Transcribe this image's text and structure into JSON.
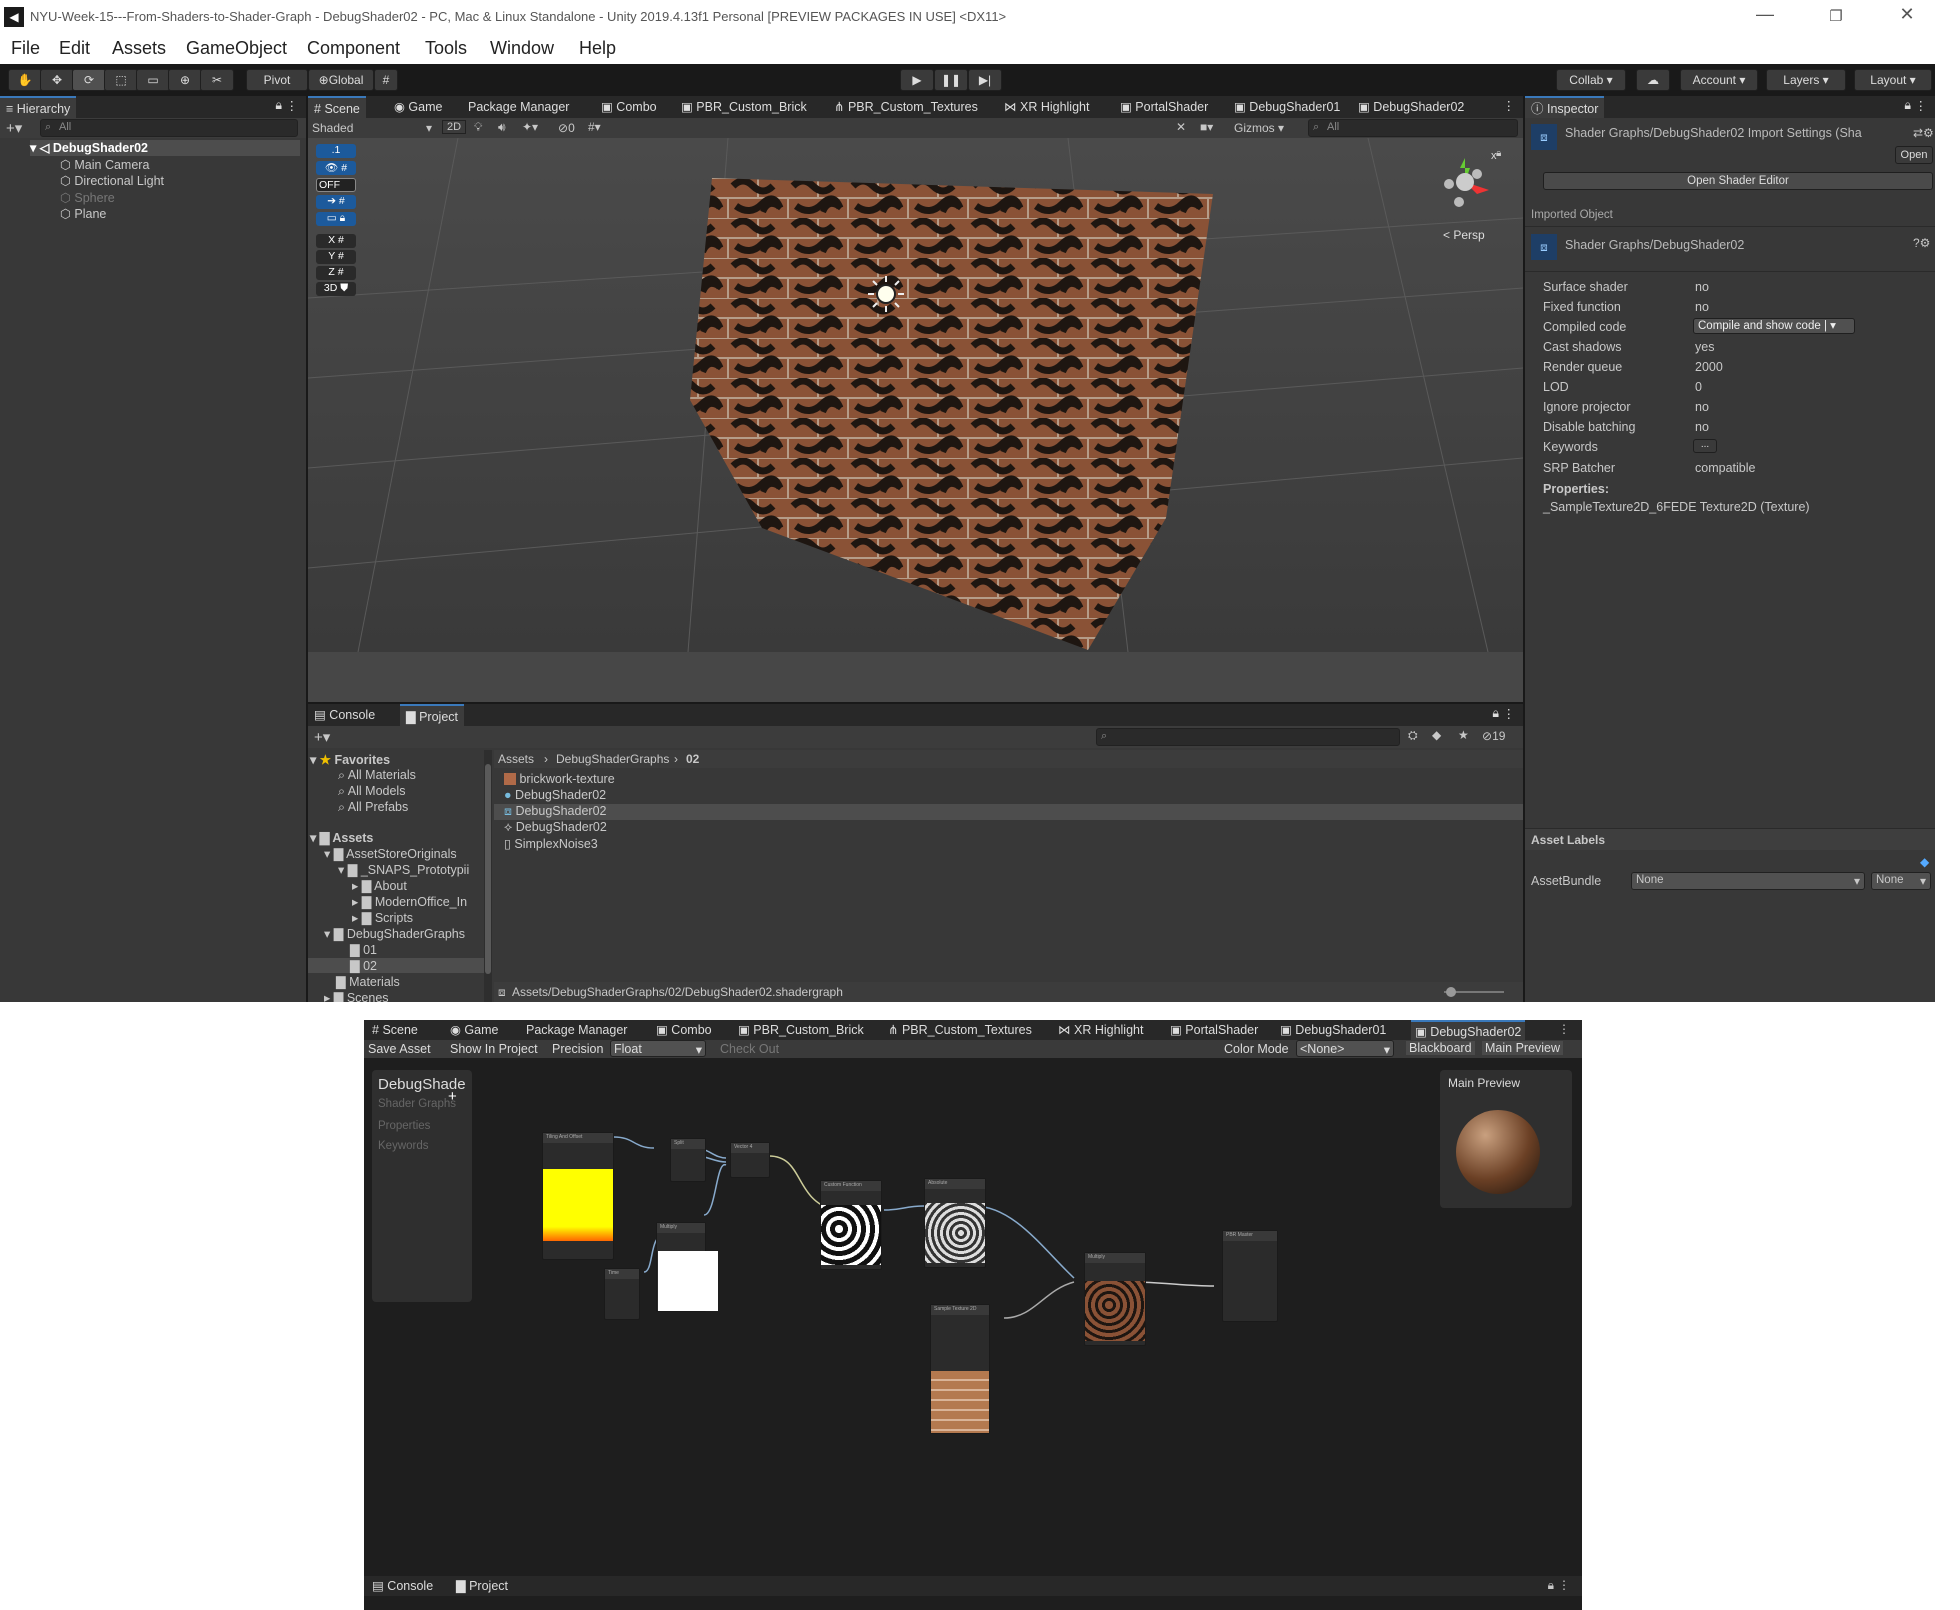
{
  "window": {
    "title": "NYU-Week-15---From-Shaders-to-Shader-Graph - DebugShader02 - PC, Mac & Linux Standalone - Unity 2019.4.13f1 Personal [PREVIEW PACKAGES IN USE] <DX11>",
    "menu": [
      "File",
      "Edit",
      "Assets",
      "GameObject",
      "Component",
      "Tools",
      "Window",
      "Help"
    ]
  },
  "toolbar": {
    "pivot": "Pivot",
    "global": "Global",
    "collab": "Collab",
    "account": "Account",
    "layers": "Layers",
    "layout": "Layout"
  },
  "hierarchy": {
    "tab": "Hierarchy",
    "search_placeholder": "All",
    "scene": "DebugShader02",
    "items": [
      {
        "label": "Main Camera"
      },
      {
        "label": "Directional Light"
      },
      {
        "label": "Sphere"
      },
      {
        "label": "Plane"
      }
    ]
  },
  "scene_tabs": [
    "Scene",
    "Game",
    "Package Manager",
    "Combo",
    "PBR_Custom_Brick",
    "PBR_Custom_Textures",
    "XR Highlight",
    "PortalShader",
    "DebugShader01",
    "DebugShader02"
  ],
  "scene_toolbar": {
    "shading": "Shaded",
    "mode2d": "2D",
    "hidden_count": "0",
    "gizmos": "Gizmos",
    "search_placeholder": "All"
  },
  "scene_overlay": {
    "snap_value": ".1",
    "off": "OFF",
    "x": "X",
    "y": "Y",
    "z": "Z",
    "three_d": "3D",
    "persp": "< Persp",
    "gizmo_y": "y",
    "gizmo_x": "x"
  },
  "inspector": {
    "tab": "Inspector",
    "header": "Shader Graphs/DebugShader02 Import Settings (Sha",
    "open": "Open",
    "open_editor": "Open Shader Editor",
    "imported_object": "Imported Object",
    "object_name": "Shader Graphs/DebugShader02",
    "props": [
      {
        "k": "Surface shader",
        "v": "no"
      },
      {
        "k": "Fixed function",
        "v": "no"
      },
      {
        "k": "Compiled code",
        "v": "Compile and show code"
      },
      {
        "k": "Cast shadows",
        "v": "yes"
      },
      {
        "k": "Render queue",
        "v": "2000"
      },
      {
        "k": "LOD",
        "v": "0"
      },
      {
        "k": "Ignore projector",
        "v": "no"
      },
      {
        "k": "Disable batching",
        "v": "no"
      },
      {
        "k": "Keywords",
        "v": "..."
      },
      {
        "k": "SRP Batcher",
        "v": "compatible"
      }
    ],
    "properties_label": "Properties:",
    "property_item": "_SampleTexture2D_6FEDE Texture2D (Texture)",
    "asset_labels": "Asset Labels",
    "asset_bundle": "AssetBundle",
    "bundle_value": "None",
    "bundle_variant": "None"
  },
  "project": {
    "tabs": [
      "Console",
      "Project"
    ],
    "hidden_count": "19",
    "favorites": "Favorites",
    "fav_items": [
      "All Materials",
      "All Models",
      "All Prefabs"
    ],
    "tree": [
      {
        "label": "Assets",
        "bold": true,
        "depth": 0
      },
      {
        "label": "AssetStoreOriginals",
        "depth": 1
      },
      {
        "label": "_SNAPS_Prototypii",
        "depth": 2
      },
      {
        "label": "About",
        "depth": 3
      },
      {
        "label": "ModernOffice_In",
        "depth": 3
      },
      {
        "label": "Scripts",
        "depth": 3
      },
      {
        "label": "DebugShaderGraphs",
        "depth": 1
      },
      {
        "label": "01",
        "depth": 2
      },
      {
        "label": "02",
        "depth": 2,
        "selected": true
      },
      {
        "label": "Materials",
        "depth": 1
      },
      {
        "label": "Scenes",
        "depth": 1
      },
      {
        "label": "Scripts",
        "depth": 1
      },
      {
        "label": "Settings",
        "depth": 1
      },
      {
        "label": "Shaders",
        "depth": 1
      }
    ],
    "breadcrumb": [
      "Assets",
      "DebugShaderGraphs",
      "02"
    ],
    "files": [
      {
        "label": "brickwork-texture",
        "icon": "texture-icon"
      },
      {
        "label": "DebugShader02",
        "icon": "material-icon"
      },
      {
        "label": "DebugShader02",
        "icon": "shadergraph-icon",
        "selected": true
      },
      {
        "label": "DebugShader02",
        "icon": "shader-icon"
      },
      {
        "label": "SimplexNoise3",
        "icon": "script-icon"
      }
    ],
    "path": "Assets/DebugShaderGraphs/02/DebugShader02.shadergraph"
  },
  "graph_editor": {
    "tabs": [
      "Scene",
      "Game",
      "Package Manager",
      "Combo",
      "PBR_Custom_Brick",
      "PBR_Custom_Textures",
      "XR Highlight",
      "PortalShader",
      "DebugShader01",
      "DebugShader02"
    ],
    "save": "Save Asset",
    "show": "Show In Project",
    "precision_label": "Precision",
    "precision": "Float",
    "checkout": "Check Out",
    "color_mode_label": "Color Mode",
    "color_mode": "<None>",
    "blackboard": "Blackboard",
    "main_preview": "Main Preview",
    "bb_title": "DebugShade",
    "bb_sub": "Shader Graphs",
    "bb_properties": "Properties",
    "bb_keywords": "Keywords",
    "preview_title": "Main Preview",
    "nodes": {
      "tiling": "Tiling And Offset",
      "split": "Split",
      "vector4": "Vector 4",
      "multiply1": "Multiply",
      "time": "Time",
      "custom": "Custom Function",
      "absolute": "Absolute",
      "multiply2": "Multiply",
      "sample": "Sample Texture 2D",
      "pbr": "PBR Master"
    },
    "bottom_tabs": [
      "Console",
      "Project"
    ]
  }
}
